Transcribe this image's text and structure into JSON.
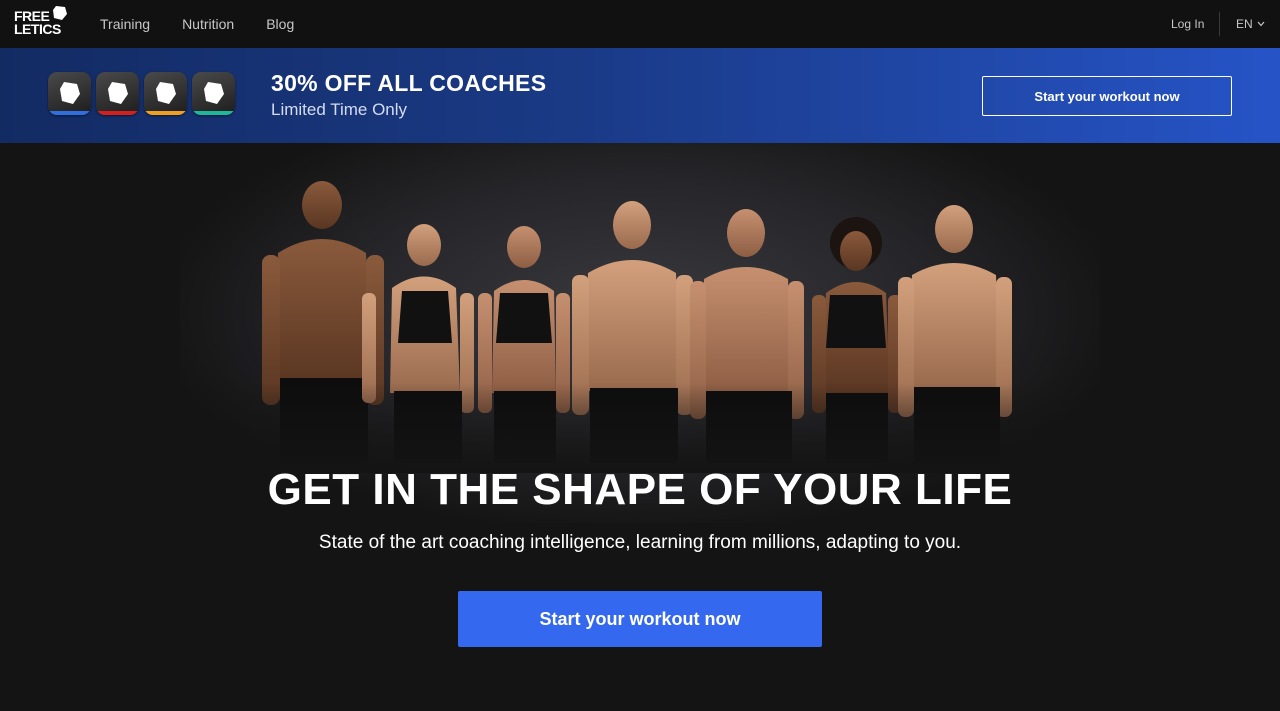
{
  "brand": {
    "logo_line1": "FREE",
    "logo_line2": "LETICS"
  },
  "nav": {
    "links": [
      "Training",
      "Nutrition",
      "Blog"
    ],
    "login": "Log In",
    "language": "EN"
  },
  "promo": {
    "title": "30% OFF ALL COACHES",
    "subtitle": "Limited Time Only",
    "button": "Start your workout now",
    "app_icon_colors": [
      "#2f6fe0",
      "#d62020",
      "#f0a020",
      "#1fb89a"
    ]
  },
  "hero": {
    "image": "group of seven athletes in black sportswear",
    "headline": "GET IN THE SHAPE OF YOUR LIFE",
    "subheadline": "State of the art coaching intelligence, learning from millions, adapting to you.",
    "cta": "Start your workout now"
  },
  "colors": {
    "nav_bg": "#111111",
    "cta_blue": "#3468ee",
    "banner_gradient_start": "#132b63",
    "banner_gradient_end": "#2654c7"
  }
}
